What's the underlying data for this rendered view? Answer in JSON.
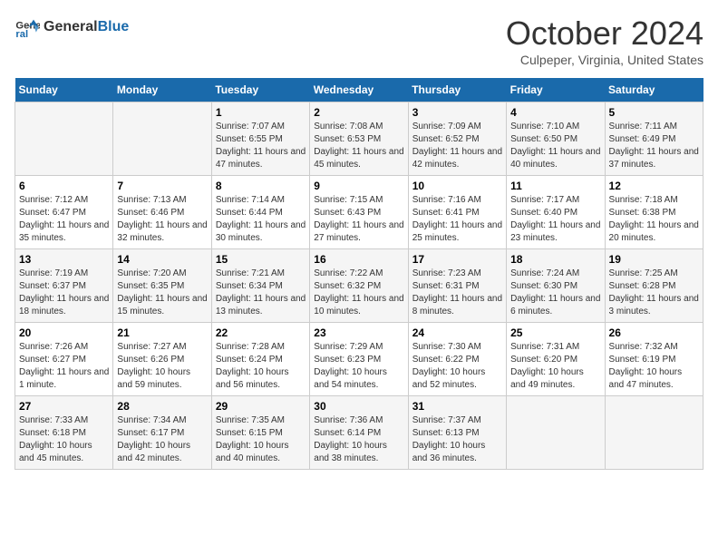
{
  "header": {
    "logo_line1": "General",
    "logo_line2": "Blue",
    "month": "October 2024",
    "location": "Culpeper, Virginia, United States"
  },
  "days_of_week": [
    "Sunday",
    "Monday",
    "Tuesday",
    "Wednesday",
    "Thursday",
    "Friday",
    "Saturday"
  ],
  "weeks": [
    [
      {
        "day": "",
        "info": ""
      },
      {
        "day": "",
        "info": ""
      },
      {
        "day": "1",
        "info": "Sunrise: 7:07 AM\nSunset: 6:55 PM\nDaylight: 11 hours and 47 minutes."
      },
      {
        "day": "2",
        "info": "Sunrise: 7:08 AM\nSunset: 6:53 PM\nDaylight: 11 hours and 45 minutes."
      },
      {
        "day": "3",
        "info": "Sunrise: 7:09 AM\nSunset: 6:52 PM\nDaylight: 11 hours and 42 minutes."
      },
      {
        "day": "4",
        "info": "Sunrise: 7:10 AM\nSunset: 6:50 PM\nDaylight: 11 hours and 40 minutes."
      },
      {
        "day": "5",
        "info": "Sunrise: 7:11 AM\nSunset: 6:49 PM\nDaylight: 11 hours and 37 minutes."
      }
    ],
    [
      {
        "day": "6",
        "info": "Sunrise: 7:12 AM\nSunset: 6:47 PM\nDaylight: 11 hours and 35 minutes."
      },
      {
        "day": "7",
        "info": "Sunrise: 7:13 AM\nSunset: 6:46 PM\nDaylight: 11 hours and 32 minutes."
      },
      {
        "day": "8",
        "info": "Sunrise: 7:14 AM\nSunset: 6:44 PM\nDaylight: 11 hours and 30 minutes."
      },
      {
        "day": "9",
        "info": "Sunrise: 7:15 AM\nSunset: 6:43 PM\nDaylight: 11 hours and 27 minutes."
      },
      {
        "day": "10",
        "info": "Sunrise: 7:16 AM\nSunset: 6:41 PM\nDaylight: 11 hours and 25 minutes."
      },
      {
        "day": "11",
        "info": "Sunrise: 7:17 AM\nSunset: 6:40 PM\nDaylight: 11 hours and 23 minutes."
      },
      {
        "day": "12",
        "info": "Sunrise: 7:18 AM\nSunset: 6:38 PM\nDaylight: 11 hours and 20 minutes."
      }
    ],
    [
      {
        "day": "13",
        "info": "Sunrise: 7:19 AM\nSunset: 6:37 PM\nDaylight: 11 hours and 18 minutes."
      },
      {
        "day": "14",
        "info": "Sunrise: 7:20 AM\nSunset: 6:35 PM\nDaylight: 11 hours and 15 minutes."
      },
      {
        "day": "15",
        "info": "Sunrise: 7:21 AM\nSunset: 6:34 PM\nDaylight: 11 hours and 13 minutes."
      },
      {
        "day": "16",
        "info": "Sunrise: 7:22 AM\nSunset: 6:32 PM\nDaylight: 11 hours and 10 minutes."
      },
      {
        "day": "17",
        "info": "Sunrise: 7:23 AM\nSunset: 6:31 PM\nDaylight: 11 hours and 8 minutes."
      },
      {
        "day": "18",
        "info": "Sunrise: 7:24 AM\nSunset: 6:30 PM\nDaylight: 11 hours and 6 minutes."
      },
      {
        "day": "19",
        "info": "Sunrise: 7:25 AM\nSunset: 6:28 PM\nDaylight: 11 hours and 3 minutes."
      }
    ],
    [
      {
        "day": "20",
        "info": "Sunrise: 7:26 AM\nSunset: 6:27 PM\nDaylight: 11 hours and 1 minute."
      },
      {
        "day": "21",
        "info": "Sunrise: 7:27 AM\nSunset: 6:26 PM\nDaylight: 10 hours and 59 minutes."
      },
      {
        "day": "22",
        "info": "Sunrise: 7:28 AM\nSunset: 6:24 PM\nDaylight: 10 hours and 56 minutes."
      },
      {
        "day": "23",
        "info": "Sunrise: 7:29 AM\nSunset: 6:23 PM\nDaylight: 10 hours and 54 minutes."
      },
      {
        "day": "24",
        "info": "Sunrise: 7:30 AM\nSunset: 6:22 PM\nDaylight: 10 hours and 52 minutes."
      },
      {
        "day": "25",
        "info": "Sunrise: 7:31 AM\nSunset: 6:20 PM\nDaylight: 10 hours and 49 minutes."
      },
      {
        "day": "26",
        "info": "Sunrise: 7:32 AM\nSunset: 6:19 PM\nDaylight: 10 hours and 47 minutes."
      }
    ],
    [
      {
        "day": "27",
        "info": "Sunrise: 7:33 AM\nSunset: 6:18 PM\nDaylight: 10 hours and 45 minutes."
      },
      {
        "day": "28",
        "info": "Sunrise: 7:34 AM\nSunset: 6:17 PM\nDaylight: 10 hours and 42 minutes."
      },
      {
        "day": "29",
        "info": "Sunrise: 7:35 AM\nSunset: 6:15 PM\nDaylight: 10 hours and 40 minutes."
      },
      {
        "day": "30",
        "info": "Sunrise: 7:36 AM\nSunset: 6:14 PM\nDaylight: 10 hours and 38 minutes."
      },
      {
        "day": "31",
        "info": "Sunrise: 7:37 AM\nSunset: 6:13 PM\nDaylight: 10 hours and 36 minutes."
      },
      {
        "day": "",
        "info": ""
      },
      {
        "day": "",
        "info": ""
      }
    ]
  ]
}
